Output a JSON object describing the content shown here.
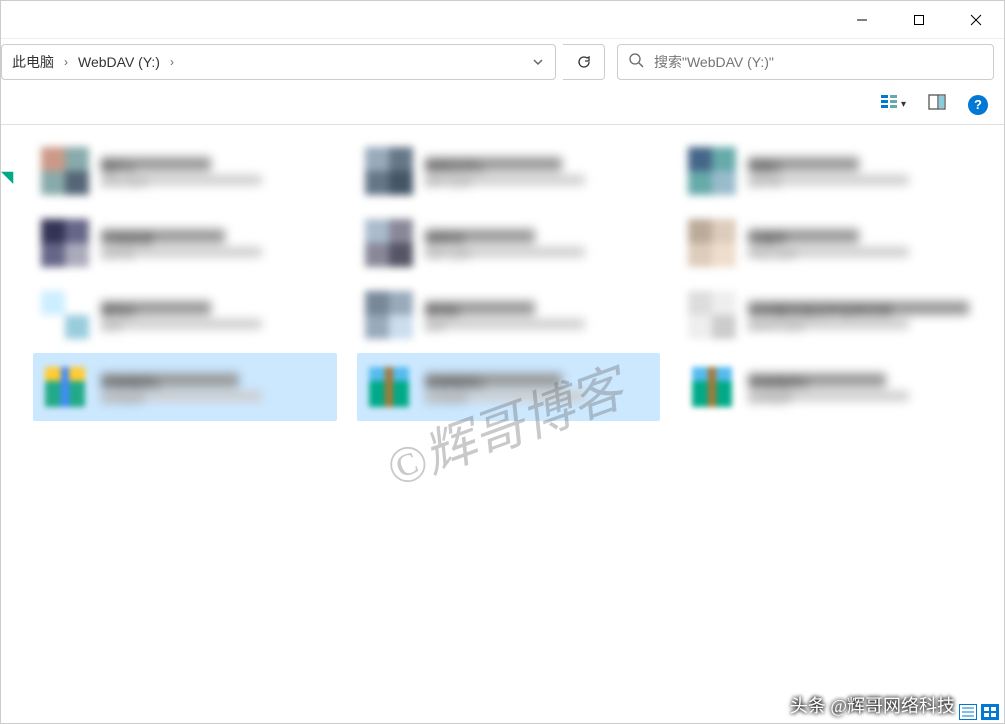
{
  "breadcrumb": {
    "parts": [
      "此电脑",
      "WebDAV (Y:)"
    ]
  },
  "search": {
    "placeholder": "搜索\"WebDAV (Y:)\""
  },
  "watermark": "©辉哥博客",
  "credit": "头条 @辉哥网络科技",
  "files": [
    {
      "name": "图片1",
      "meta": "JPG 文件",
      "selected": false,
      "thumb": "img",
      "colors": [
        "#8aa",
        "#c98",
        "#567"
      ]
    },
    {
      "name": "视频文件1",
      "meta": "MP4 文件",
      "selected": false,
      "thumb": "img",
      "colors": [
        "#678",
        "#9ab",
        "#456"
      ]
    },
    {
      "name": "相册2",
      "meta": "文件夹",
      "selected": false,
      "thumb": "img",
      "colors": [
        "#6aa",
        "#468",
        "#9bc"
      ]
    },
    {
      "name": "文档目录",
      "meta": "文件夹",
      "selected": false,
      "thumb": "img",
      "colors": [
        "#668",
        "#335",
        "#aab"
      ]
    },
    {
      "name": "说明书",
      "meta": "PDF 文件",
      "selected": false,
      "thumb": "img",
      "colors": [
        "#889",
        "#abc",
        "#556"
      ]
    },
    {
      "name": "扫描件",
      "meta": "PNG 文件",
      "selected": false,
      "thumb": "img",
      "colors": [
        "#dcb",
        "#ba9",
        "#edc"
      ]
    },
    {
      "name": "素材A",
      "meta": "文件",
      "selected": false,
      "thumb": "img",
      "colors": [
        "#fff",
        "#cef",
        "#9cd"
      ]
    },
    {
      "name": "素材B",
      "meta": "文件",
      "selected": false,
      "thumb": "img",
      "colors": [
        "#9ab",
        "#789",
        "#cde"
      ]
    },
    {
      "name": "长标题文档文件名称示例",
      "meta": "DOCX 文件",
      "selected": false,
      "thumb": "img",
      "colors": [
        "#eee",
        "#ddd",
        "#ccc"
      ]
    },
    {
      "name": "安装程序1",
      "meta": "应用程序",
      "selected": true,
      "thumb": "app1",
      "colors": [
        "#fc3",
        "#2a8",
        "#48f"
      ]
    },
    {
      "name": "安装程序2",
      "meta": "应用程序",
      "selected": true,
      "thumb": "app2",
      "colors": [
        "#5be",
        "#0a8",
        "#a73"
      ]
    },
    {
      "name": "安装程序3",
      "meta": "应用程序",
      "selected": false,
      "thumb": "app3",
      "colors": [
        "#5be",
        "#0a8",
        "#a73"
      ]
    }
  ]
}
